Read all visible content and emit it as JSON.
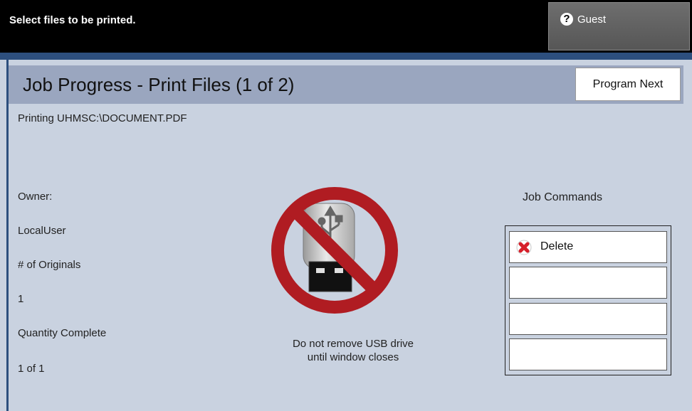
{
  "header": {
    "instruction": "Select files to be printed.",
    "user_button_label": "Guest",
    "user_icon_glyph": "?"
  },
  "window": {
    "title": "Job Progress - Print Files (1 of 2)",
    "program_next_label": "Program Next",
    "status": "Printing UHMSC:\\DOCUMENT.PDF"
  },
  "details": {
    "owner_label": "Owner:",
    "owner_value": "LocalUser",
    "originals_label": "# of Originals",
    "originals_value": "1",
    "quantity_label": "Quantity Complete",
    "quantity_value": "1 of 1"
  },
  "warning": {
    "line1": "Do not remove USB drive",
    "line2": "until window closes",
    "icon": "no-usb-removal-icon"
  },
  "job_commands": {
    "title": "Job Commands",
    "buttons": [
      {
        "label": "Delete",
        "icon": "delete-x-icon"
      },
      {
        "label": ""
      },
      {
        "label": ""
      },
      {
        "label": ""
      }
    ]
  },
  "colors": {
    "top_bar": "#000000",
    "accent_strip": "#2d4f7e",
    "window_bg": "#c9d2e0",
    "title_bar": "#9aa6bf",
    "prohibit_red": "#b01c22",
    "delete_red": "#d6202a"
  }
}
